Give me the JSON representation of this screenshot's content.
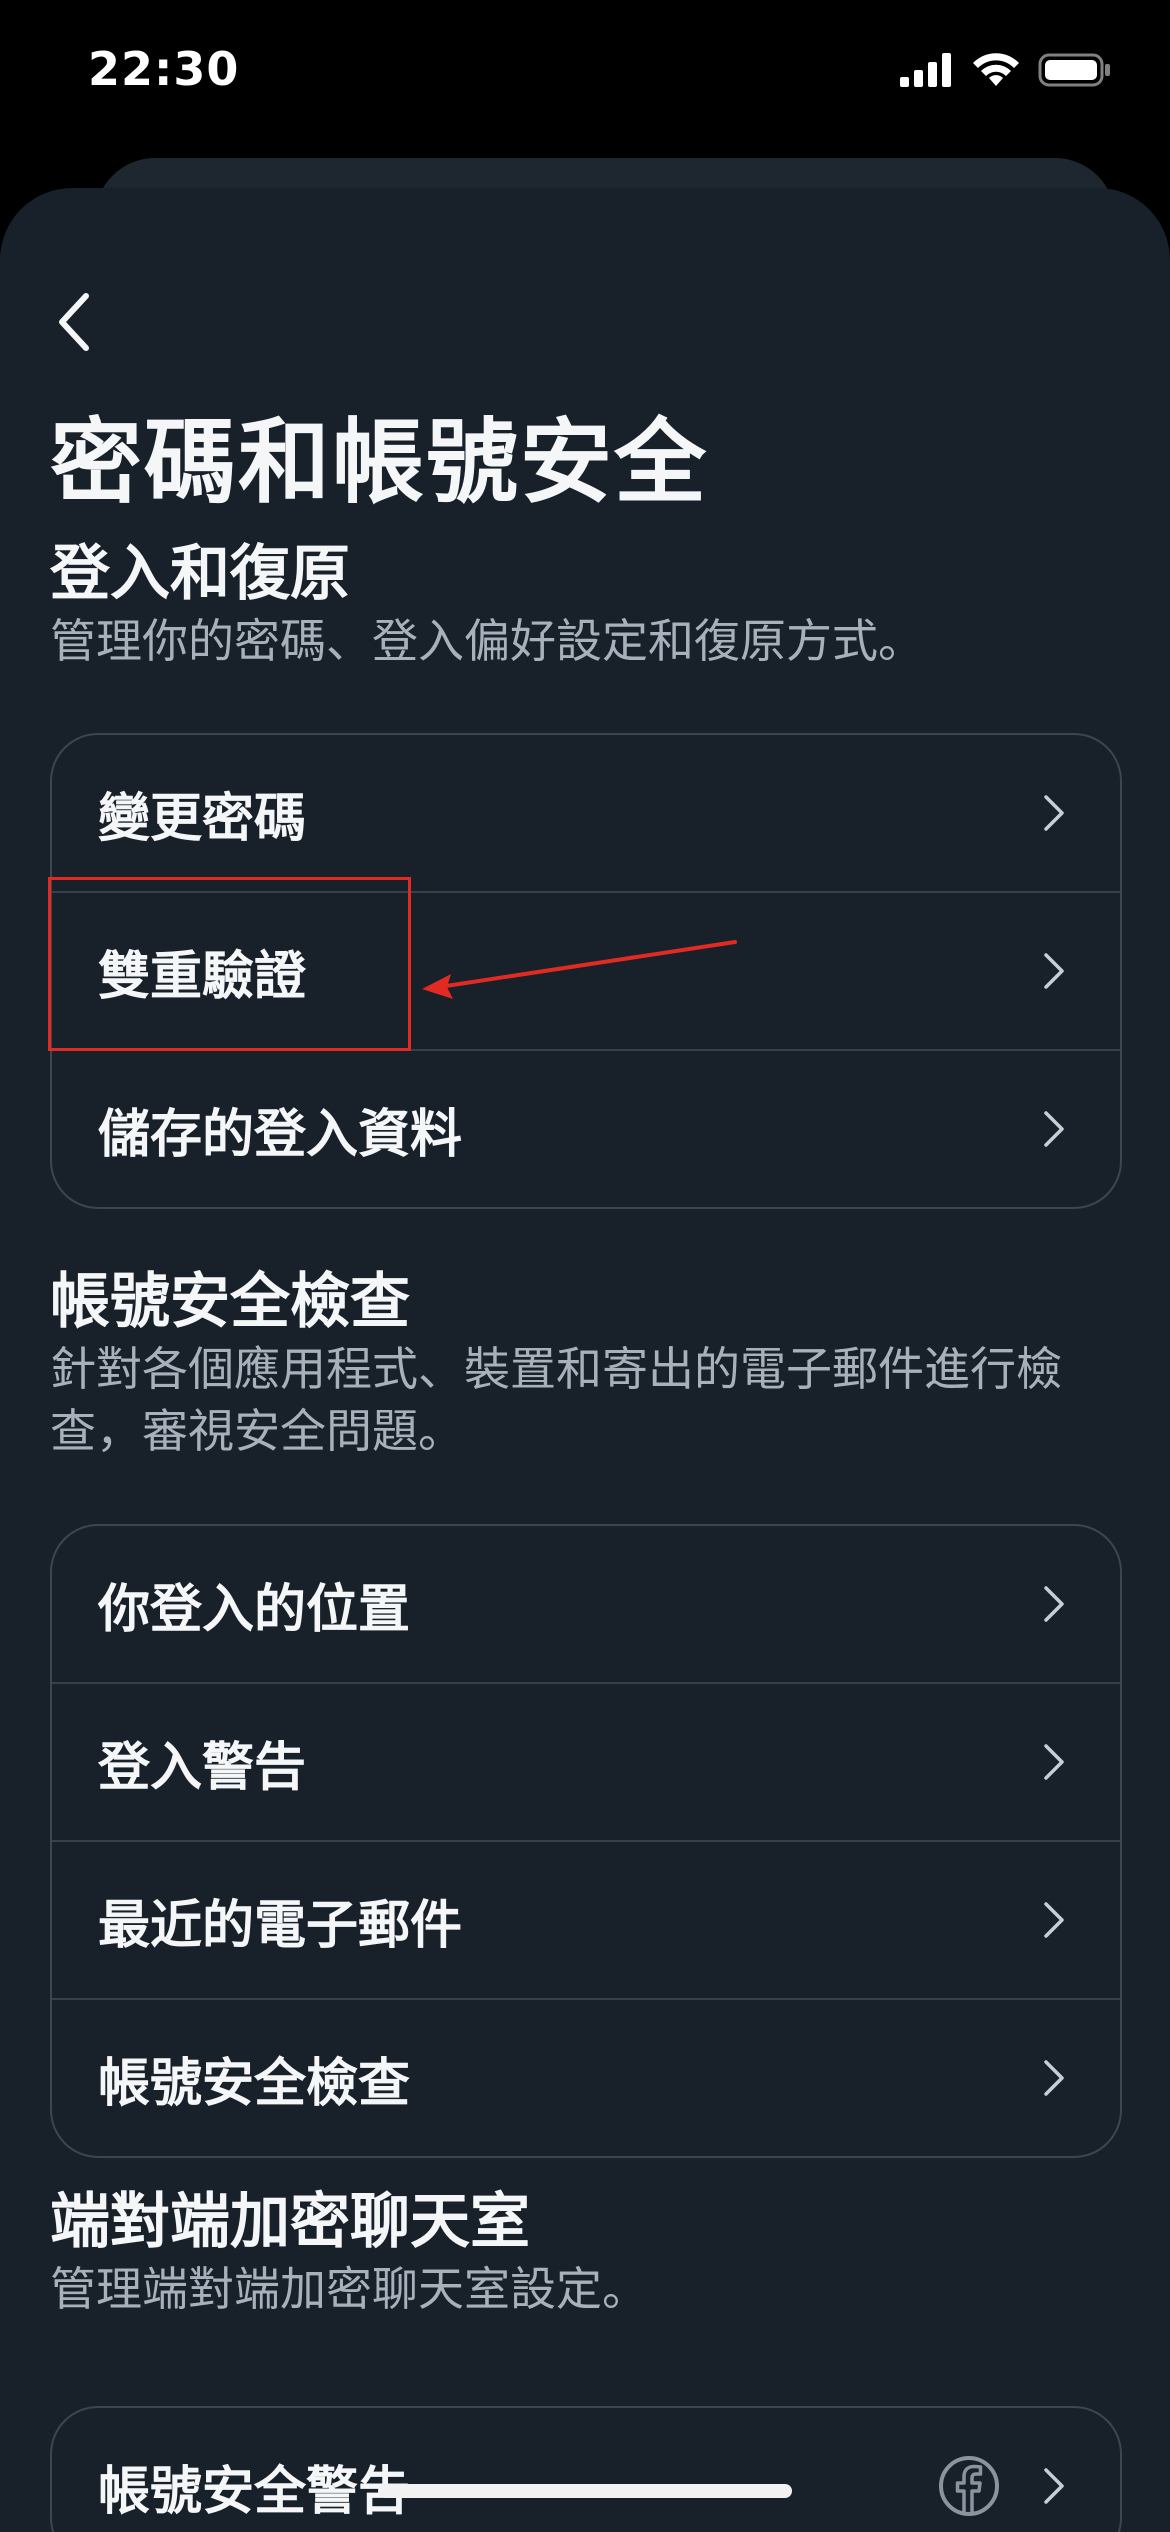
{
  "status_bar": {
    "time": "22:30",
    "icons": [
      "cellular-signal-icon",
      "wifi-icon",
      "battery-icon"
    ]
  },
  "header": {
    "back_icon": "chevron-left-icon",
    "title": "密碼和帳號安全"
  },
  "sections": [
    {
      "title": "登入和復原",
      "description": "管理你的密碼、登入偏好設定和復原方式。",
      "items": [
        {
          "label": "變更密碼"
        },
        {
          "label": "雙重驗證"
        },
        {
          "label": "儲存的登入資料"
        }
      ]
    },
    {
      "title": "帳號安全檢查",
      "description": "針對各個應用程式、裝置和寄出的電子郵件進行檢查，審視安全問題。",
      "items": [
        {
          "label": "你登入的位置"
        },
        {
          "label": "登入警告"
        },
        {
          "label": "最近的電子郵件"
        },
        {
          "label": "帳號安全檢查"
        }
      ]
    },
    {
      "title": "端對端加密聊天室",
      "description": "管理端對端加密聊天室設定。",
      "items": [
        {
          "label": "帳號安全警告",
          "icon": "facebook-icon"
        }
      ]
    }
  ],
  "colors": {
    "background": "#18202a",
    "text_primary": "#f4f6f8",
    "text_secondary": "#a8b1bb",
    "card_border": "#3a4652",
    "annotation": "#e02a22"
  }
}
